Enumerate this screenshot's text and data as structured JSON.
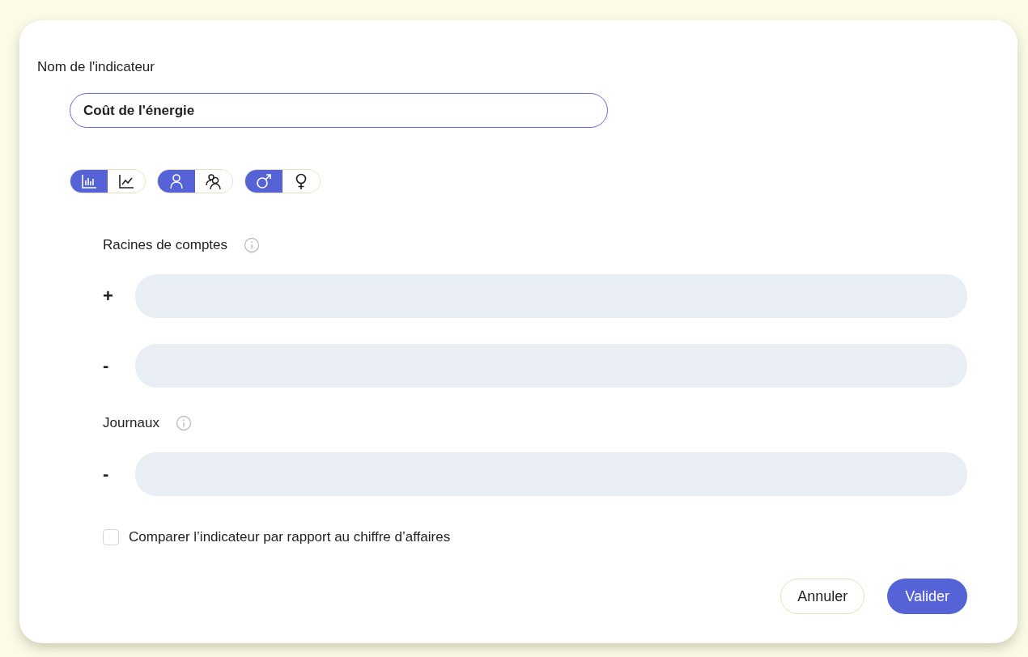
{
  "name_label": "Nom de l'indicateur",
  "name_field": {
    "value": "Coût de l'énergie"
  },
  "toggle_groups": [
    {
      "options": [
        {
          "kind": "bar-chart",
          "selected": true
        },
        {
          "kind": "line-chart",
          "selected": false
        }
      ]
    },
    {
      "options": [
        {
          "kind": "person",
          "selected": true
        },
        {
          "kind": "people",
          "selected": false
        }
      ]
    },
    {
      "options": [
        {
          "kind": "male",
          "selected": true
        },
        {
          "kind": "female",
          "selected": false
        }
      ]
    }
  ],
  "sections": [
    {
      "title": "Racines de comptes",
      "rows": [
        {
          "sign": "+"
        },
        {
          "sign": "-"
        }
      ]
    },
    {
      "title": "Journaux",
      "rows": [
        {
          "sign": "-"
        }
      ]
    }
  ],
  "compare_checkbox": {
    "label": "Comparer l’indicateur par rapport au chiffre d’affaires",
    "checked": false
  },
  "buttons": [
    {
      "label": "Annuler",
      "kind": "secondary"
    },
    {
      "label": "Valider",
      "kind": "primary"
    }
  ]
}
